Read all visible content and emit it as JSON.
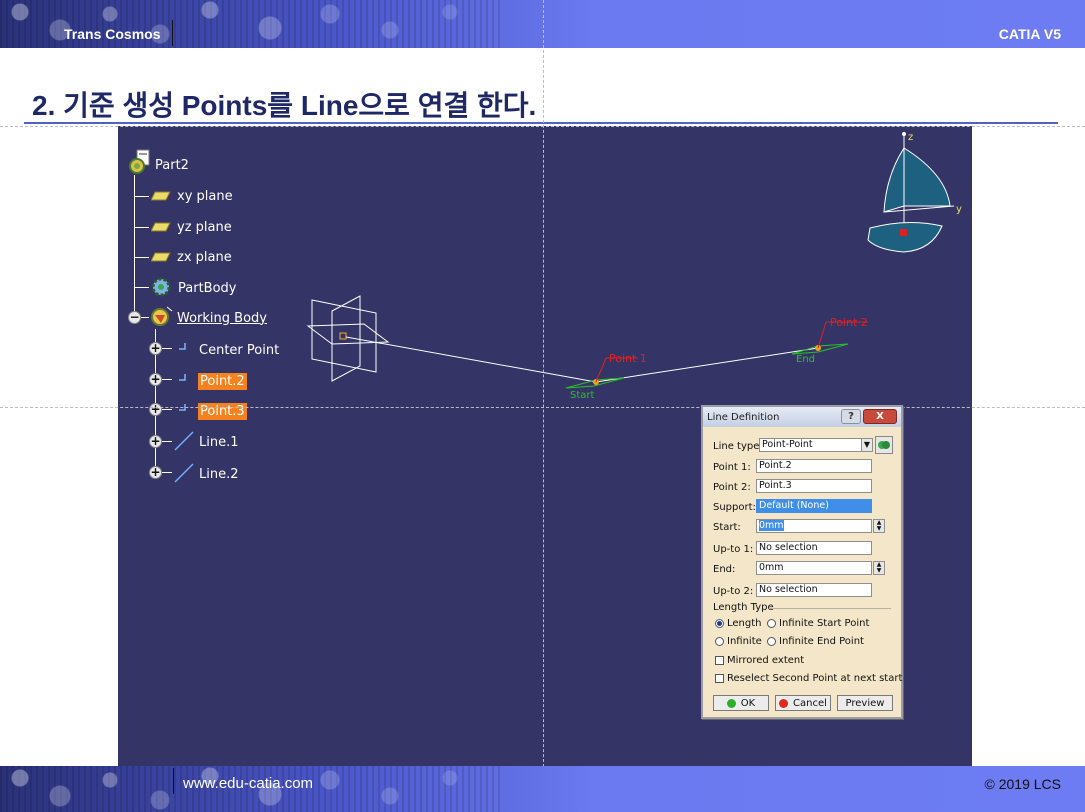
{
  "header": {
    "brand": "Trans Cosmos",
    "product": "CATIA V5"
  },
  "title": {
    "number": "2.",
    "text": " 기준 생성 Points를 Line으로 연결 한다."
  },
  "footer": {
    "site": "www.edu-catia.com",
    "copyright": "© 2019 LCS"
  },
  "tree": {
    "root": "Part2",
    "items": [
      {
        "label": "xy plane",
        "icon": "plane-icon"
      },
      {
        "label": "yz plane",
        "icon": "plane-icon"
      },
      {
        "label": "zx plane",
        "icon": "plane-icon"
      },
      {
        "label": "PartBody",
        "icon": "gear-icon"
      },
      {
        "label": "Working Body",
        "icon": "working-body-icon"
      },
      {
        "label": "Center Point",
        "icon": "point-icon"
      },
      {
        "label": "Point.2",
        "icon": "point-icon"
      },
      {
        "label": "Point.3",
        "icon": "point-icon"
      },
      {
        "label": "Line.1",
        "icon": "line-icon"
      },
      {
        "label": "Line.2",
        "icon": "line-icon"
      }
    ]
  },
  "geometry_labels": {
    "point1": "Point 1",
    "point2": "Point 2",
    "start": "Start",
    "end": "End",
    "compass_z": "z",
    "compass_y": "y"
  },
  "dialog": {
    "title": "Line Definition",
    "help": "?",
    "close": "X",
    "line_type_label": "Line type :",
    "line_type_value": "Point-Point",
    "point1_label": "Point 1:",
    "point1_value": "Point.2",
    "point2_label": "Point 2:",
    "point2_value": "Point.3",
    "support_label": "Support:",
    "support_value": "Default (None)",
    "start_label": "Start:",
    "start_value": "0mm",
    "upto1_label": "Up-to 1:",
    "upto1_value": "No selection",
    "end_label": "End:",
    "end_value": "0mm",
    "upto2_label": "Up-to 2:",
    "upto2_value": "No selection",
    "length_type_label": "Length Type",
    "radio_length": "Length",
    "radio_infinite_start": "Infinite Start Point",
    "radio_infinite": "Infinite",
    "radio_infinite_end": "Infinite End Point",
    "mirrored": "Mirrored extent",
    "reselect": "Reselect Second Point at next start",
    "ok": "OK",
    "cancel": "Cancel",
    "preview": "Preview"
  },
  "colors": {
    "viewport_bg": "#353467",
    "highlight": "#f5821f",
    "band": "#6d7cf2",
    "title_text": "#1e2866",
    "dialog_bg": "#f4e6c8"
  }
}
